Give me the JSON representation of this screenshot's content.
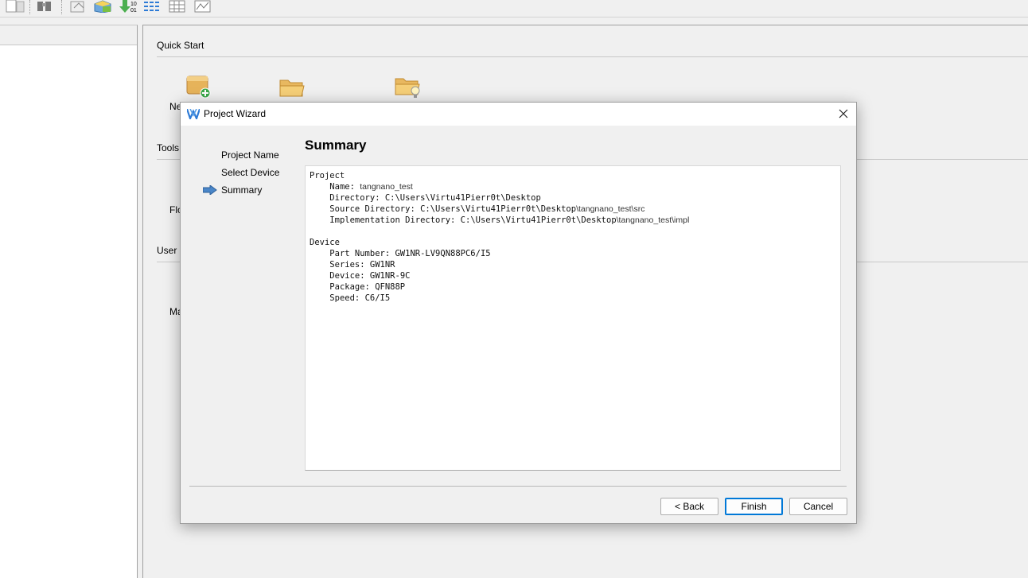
{
  "main": {
    "quick_start_label": "Quick Start",
    "quick_start_items": [
      "Ne",
      "",
      ""
    ],
    "tools_label": "Tools",
    "tools_item": "Flo",
    "user_label": "User M",
    "user_item": "Ma"
  },
  "dialog": {
    "title": "Project Wizard",
    "steps": [
      "Project Name",
      "Select Device",
      "Summary"
    ],
    "current_step": "Summary",
    "heading": "Summary",
    "summary": {
      "project_label": "Project",
      "name_key": "Name:",
      "name_value": "tangnano_test",
      "directory_key": "Directory:",
      "directory_value": "C:\\Users\\Virtu41Pierr0t\\Desktop",
      "source_key": "Source Directory:",
      "source_prefix": "C:\\Users\\Virtu41Pierr0t\\Desktop",
      "source_suffix": "\\tangnano_test\\src",
      "impl_key": "Implementation Directory:",
      "impl_prefix": "C:\\Users\\Virtu41Pierr0t\\Desktop",
      "impl_suffix": "\\tangnano_test\\impl",
      "device_label": "Device",
      "part_key": "Part Number:",
      "part_value": "GW1NR-LV9QN88PC6/I5",
      "series_key": "Series:",
      "series_value": "GW1NR",
      "device_key": "Device:",
      "device_value": "GW1NR-9C",
      "package_key": "Package:",
      "package_value": "QFN88P",
      "speed_key": "Speed:",
      "speed_value": "C6/I5"
    },
    "buttons": {
      "back": "< Back",
      "finish": "Finish",
      "cancel": "Cancel"
    }
  },
  "colors": {
    "accent": "#0078d7",
    "step_arrow": "#4a86c8"
  }
}
